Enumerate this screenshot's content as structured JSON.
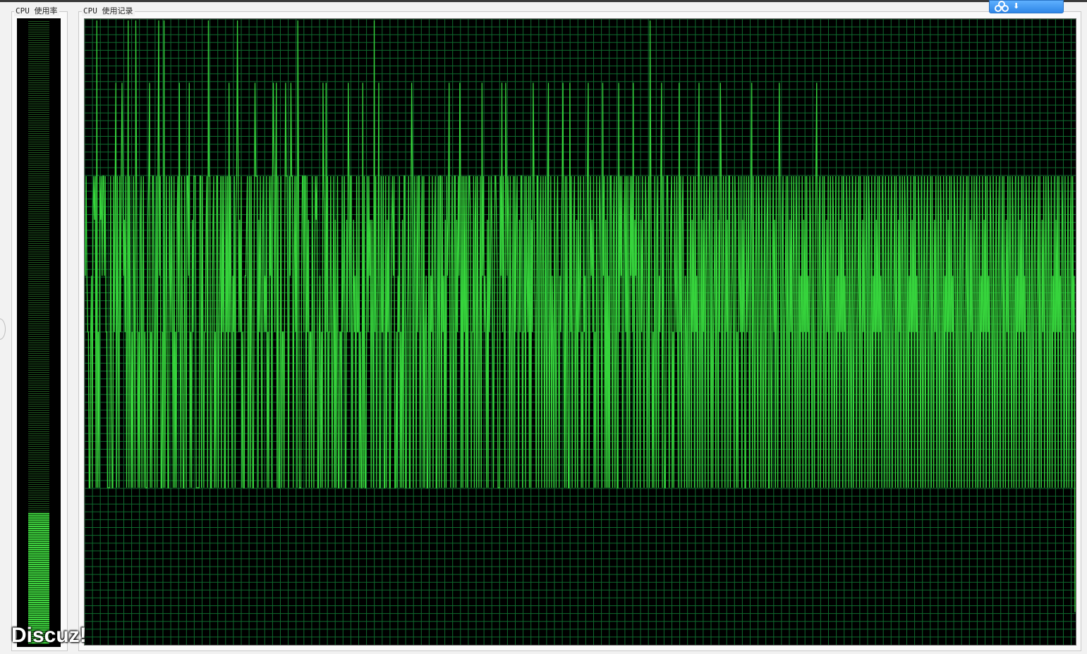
{
  "panels": {
    "usage": {
      "label": "CPU 使用率",
      "percent": 21
    },
    "history": {
      "label": "CPU 使用记录"
    }
  },
  "watermark": "Discuz!",
  "colors": {
    "grid": "#0f6b2e",
    "trace": "#36d43c",
    "background": "#000000",
    "meter_fill": "#3fd03f"
  },
  "cloud_button": {
    "icon": "cloud-icon"
  },
  "history_data": {
    "series_percent": [
      59,
      75,
      59,
      50,
      50,
      25,
      25,
      50,
      59,
      25,
      68,
      75,
      68,
      75,
      25,
      100,
      25,
      50,
      25,
      75,
      68,
      75,
      59,
      75,
      75,
      59,
      75,
      50,
      50,
      25,
      25,
      25,
      25,
      75,
      50,
      25,
      25,
      75,
      50,
      75,
      90,
      25,
      75,
      50,
      25,
      75,
      50,
      75,
      90,
      75,
      59,
      68,
      50,
      75,
      25,
      50,
      100,
      25,
      75,
      50,
      25,
      50,
      25,
      75,
      59,
      25,
      100,
      75,
      50,
      25,
      50,
      25,
      68,
      75,
      25,
      59,
      75,
      25,
      50,
      25,
      25,
      25,
      68,
      75,
      90,
      25,
      50,
      25,
      75,
      75,
      50,
      25,
      59,
      75,
      25,
      75,
      100,
      59,
      75,
      25,
      25,
      50,
      25,
      100,
      25,
      50,
      75,
      50,
      25,
      25,
      75,
      59,
      50,
      75,
      50,
      25,
      75,
      25,
      50,
      25,
      68,
      75,
      50,
      90,
      50,
      25,
      75,
      50,
      25,
      25,
      75,
      50,
      25,
      75,
      75,
      59,
      90,
      25,
      50,
      25,
      68,
      50,
      75,
      75,
      75,
      25,
      25,
      25,
      25,
      25,
      75,
      75,
      25,
      75,
      50,
      25,
      50,
      50,
      68,
      75,
      25,
      100,
      75,
      75,
      25,
      25,
      50,
      68,
      75,
      25,
      50,
      25,
      75,
      75,
      25,
      50,
      59,
      75,
      25,
      75,
      50,
      75,
      25,
      25,
      75,
      50,
      75,
      25,
      90,
      50,
      75,
      50,
      25,
      59,
      50,
      75,
      25,
      68,
      75,
      100,
      75,
      50,
      68,
      50,
      75,
      25,
      50,
      25,
      25,
      59,
      59,
      68,
      75,
      25,
      50,
      75,
      25,
      75,
      50,
      25,
      25,
      68,
      90,
      75,
      75,
      75,
      25,
      68,
      50,
      75,
      50,
      25,
      68,
      75,
      50,
      59,
      50,
      75,
      25,
      50,
      25,
      75,
      59,
      75,
      25,
      75,
      90,
      75,
      50,
      75,
      90,
      25,
      75,
      25,
      25,
      50,
      75,
      25,
      50,
      50,
      25,
      68,
      90,
      75,
      75,
      50,
      25,
      75,
      59,
      90,
      75,
      75,
      25,
      59,
      75,
      50,
      75,
      25,
      100,
      75,
      25,
      25,
      25,
      59,
      75,
      75,
      50,
      75,
      75,
      25,
      75,
      50,
      68,
      25,
      50,
      50,
      25,
      75,
      50,
      25,
      59,
      75,
      68,
      75,
      25,
      25,
      50,
      59,
      25,
      50,
      25,
      90,
      75,
      68,
      25,
      90,
      50,
      75,
      25,
      50,
      50,
      75,
      50,
      25,
      50,
      75,
      25,
      68,
      25,
      50,
      75,
      25,
      25,
      50,
      50,
      25,
      75,
      50,
      59,
      75,
      25,
      25,
      68,
      50,
      90,
      75,
      50,
      75,
      75,
      25,
      50,
      68,
      50,
      59,
      25,
      75,
      50,
      50,
      75,
      25,
      50,
      25,
      25,
      90,
      25,
      75,
      25,
      25,
      50,
      75,
      50,
      75,
      59,
      68,
      25,
      68,
      50,
      25,
      100,
      50,
      75,
      25,
      50,
      59,
      90,
      25,
      25,
      75,
      50,
      50,
      75,
      25,
      25,
      75,
      25,
      68,
      50,
      75,
      25,
      25,
      50,
      68,
      75,
      59,
      75,
      25,
      25,
      50,
      25,
      59,
      50,
      75,
      25,
      50,
      25,
      68,
      25,
      75,
      75,
      25,
      25,
      50,
      59,
      75,
      25,
      25,
      68,
      90,
      75,
      25,
      50,
      75,
      59,
      25,
      75,
      50,
      75,
      75,
      25,
      50,
      68,
      75,
      25,
      75,
      25,
      50,
      59,
      25,
      25,
      50,
      75,
      25,
      59,
      50,
      75,
      25,
      50,
      68,
      75,
      25,
      25,
      50,
      75,
      25,
      75,
      75,
      25,
      75,
      50,
      59,
      25,
      68,
      25,
      75,
      59,
      68,
      90,
      50,
      25,
      59,
      75,
      50,
      25,
      75,
      75,
      25,
      68,
      50,
      75,
      59,
      90,
      75,
      25,
      75,
      25,
      75,
      50,
      75,
      25,
      75,
      25,
      59,
      75,
      75,
      68,
      25,
      50,
      50,
      75,
      25,
      68,
      75,
      25,
      75,
      50,
      25,
      50,
      75,
      25,
      90,
      59,
      75,
      50,
      59,
      50,
      25,
      68,
      25,
      75,
      50,
      59,
      75,
      68,
      50,
      25,
      50,
      75,
      75,
      68,
      59,
      25,
      25,
      25,
      75,
      59,
      90,
      50,
      75,
      50,
      25,
      90,
      75,
      59,
      75,
      68,
      25,
      75,
      50,
      25,
      59,
      75,
      25,
      75,
      50,
      68,
      75,
      50,
      25,
      68,
      50,
      75,
      75,
      25,
      50,
      50,
      75,
      25,
      75,
      59,
      50,
      75,
      25,
      75,
      25,
      68,
      50,
      90,
      75,
      59,
      50,
      25,
      75,
      75,
      25,
      50,
      68,
      75,
      25,
      59,
      75,
      50,
      25,
      75,
      50,
      25,
      75,
      90,
      25,
      50,
      75,
      25,
      59,
      50,
      25,
      75,
      50,
      25,
      68,
      75,
      50,
      25,
      59,
      50,
      68,
      75,
      90,
      50,
      25,
      75,
      25,
      75,
      50,
      25,
      25,
      90,
      50,
      75,
      25,
      50,
      68,
      75,
      25,
      50,
      68,
      25,
      75,
      50,
      59,
      75,
      25,
      50,
      25,
      75,
      50,
      59,
      25,
      50,
      75,
      90,
      25,
      50,
      75,
      59,
      68,
      50,
      75,
      25,
      50,
      25,
      75,
      50,
      25,
      59,
      75,
      68,
      50,
      25,
      90,
      59,
      75,
      25,
      68,
      25,
      75,
      25,
      59,
      25,
      75,
      75,
      50,
      25,
      68,
      75,
      25,
      50,
      75,
      25,
      25,
      90,
      50,
      75,
      59,
      75,
      25,
      50,
      68,
      75,
      50,
      75,
      25,
      75,
      50,
      25,
      75,
      59,
      75,
      50,
      90,
      25,
      68,
      59,
      75,
      25,
      50,
      75,
      50,
      25,
      68,
      50,
      75,
      50,
      25,
      59,
      75,
      68,
      25,
      50,
      75,
      25,
      100,
      75,
      59,
      25,
      50,
      25,
      75,
      50,
      25,
      68,
      75,
      25,
      59,
      50,
      75,
      90,
      25,
      75,
      50,
      25,
      25,
      50,
      75,
      75,
      59,
      25,
      50,
      68,
      75,
      25,
      50,
      25,
      75,
      59,
      50,
      75,
      50,
      25,
      90,
      50,
      75,
      25,
      68,
      75,
      50,
      25,
      59,
      50,
      25,
      75,
      50,
      25,
      59,
      75,
      25,
      68,
      50,
      75,
      25,
      75,
      50,
      59,
      25,
      75,
      90,
      25,
      50,
      75,
      25,
      68,
      50,
      75,
      25,
      59,
      75,
      50,
      25,
      68,
      75,
      50,
      25,
      75,
      25,
      50,
      59,
      75,
      25,
      75,
      50,
      25,
      68,
      50,
      90,
      75,
      25,
      59,
      75,
      50,
      25,
      75,
      50,
      68,
      25,
      75,
      75,
      25,
      50,
      59,
      75,
      50,
      25,
      75,
      68,
      25,
      50,
      25,
      75,
      59,
      50,
      75,
      25,
      68,
      50,
      75,
      25,
      25,
      75,
      50,
      59,
      75,
      25,
      50,
      68,
      90,
      25,
      75,
      50,
      25,
      59,
      75,
      50,
      25,
      75,
      68,
      50,
      25,
      75,
      50,
      25,
      59,
      75,
      25,
      50,
      68,
      75,
      25,
      25,
      75,
      50,
      25,
      59,
      75,
      50,
      68,
      25,
      75,
      50,
      25,
      59,
      90,
      75,
      50,
      25,
      68,
      75,
      25,
      50,
      59,
      75,
      25,
      75,
      50,
      25,
      68,
      50,
      75,
      25,
      59,
      75,
      50,
      25,
      75,
      68,
      25,
      50,
      75,
      25,
      59,
      50,
      75,
      25,
      68,
      50,
      75,
      25,
      75,
      50,
      59,
      25,
      75,
      68,
      50,
      25,
      75,
      50,
      25,
      59,
      75,
      90,
      50,
      25,
      68,
      75,
      25,
      50,
      59,
      75,
      25,
      75,
      50,
      25,
      68,
      50,
      75,
      25,
      59,
      75,
      50,
      25,
      75,
      68,
      25,
      50,
      75,
      25,
      59,
      50,
      75,
      25,
      68,
      50,
      75,
      25,
      75,
      50,
      59,
      25,
      75,
      68,
      50,
      25,
      75,
      50,
      25,
      59,
      75,
      25,
      50,
      68,
      75,
      25,
      50,
      59,
      75,
      25,
      75,
      50,
      25,
      68,
      50,
      75,
      25,
      59,
      75,
      50,
      25,
      75,
      68,
      25,
      50,
      75,
      25,
      59,
      50,
      75,
      25,
      68,
      50,
      75,
      25,
      75,
      50,
      59,
      25,
      75,
      68,
      50,
      25,
      75,
      50,
      25,
      59,
      75,
      25,
      50,
      68,
      75,
      25,
      50,
      59,
      75,
      25,
      75,
      50,
      25,
      68,
      50,
      75,
      25,
      59,
      75,
      50,
      25,
      75,
      68,
      25,
      50,
      75,
      25,
      59,
      50,
      75,
      25,
      68,
      50,
      75,
      25,
      75,
      50,
      59,
      25,
      75,
      68,
      50,
      25,
      75,
      50,
      25,
      59,
      75,
      25,
      50,
      68,
      75,
      25,
      50,
      59,
      75,
      25,
      75,
      50,
      25,
      68,
      50,
      75,
      25,
      59,
      75,
      50,
      25,
      75,
      68,
      25,
      50,
      75,
      25,
      59,
      50,
      75,
      25,
      68,
      50,
      75,
      25,
      75,
      50,
      59,
      25,
      75,
      68,
      50,
      25,
      75,
      50,
      25,
      59,
      75,
      25,
      50,
      68,
      75,
      25,
      50,
      59,
      75,
      25,
      75,
      50,
      25,
      68,
      50,
      75,
      25,
      59,
      75,
      50,
      25,
      75,
      68,
      25,
      50,
      75,
      25,
      59,
      50,
      75,
      25,
      68,
      50,
      75,
      25,
      75,
      50,
      59,
      25,
      75,
      68,
      50,
      25,
      75,
      50,
      25,
      59,
      75,
      25,
      50,
      68,
      75,
      25,
      50,
      59,
      75,
      25,
      75,
      50,
      25,
      68,
      50,
      75,
      25,
      59,
      75,
      50,
      25,
      75,
      68,
      25,
      50,
      75,
      25,
      59,
      50,
      75,
      25,
      68,
      50,
      75,
      25,
      75,
      50,
      59,
      25,
      75,
      68,
      50,
      25,
      75,
      50,
      25,
      59,
      75,
      25,
      50,
      68,
      75,
      25,
      50,
      59,
      75,
      25,
      75,
      50,
      25,
      68,
      50,
      75,
      25,
      59,
      75,
      50,
      25,
      75,
      68,
      25,
      50,
      75,
      25,
      59,
      50,
      75,
      25,
      68,
      50,
      75,
      25,
      75,
      50,
      59,
      25,
      75,
      68,
      50,
      25,
      75,
      50,
      25,
      59,
      75,
      25,
      50,
      68,
      75,
      25,
      75,
      50,
      59,
      5
    ]
  }
}
